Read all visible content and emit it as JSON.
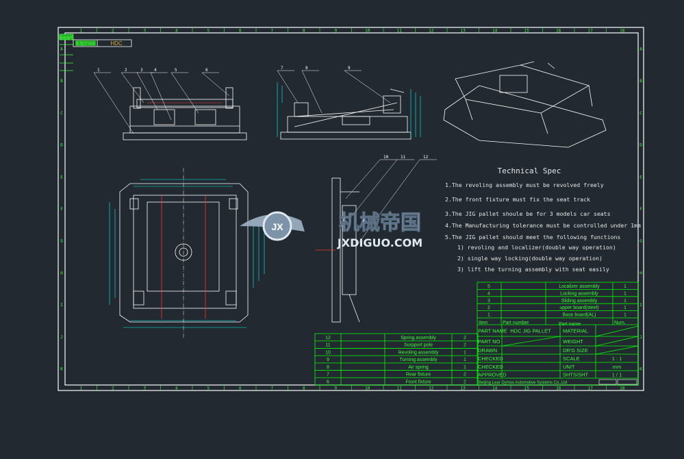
{
  "colors": {
    "background": "#222930",
    "border": "#ffffff",
    "table": "#00ff00",
    "dimension": "#00ffff",
    "geometry": "#ffffff",
    "accent": "#ff3030"
  },
  "frame": {
    "columns": [
      "1",
      "2",
      "3",
      "4",
      "5",
      "6",
      "7",
      "8",
      "9",
      "10",
      "11",
      "12",
      "13",
      "14",
      "15",
      "16",
      "17",
      "18"
    ],
    "rows": [
      "A",
      "B",
      "C",
      "D",
      "E",
      "F",
      "G",
      "H",
      "I",
      "J",
      "K"
    ],
    "corner_label": "图纸编号",
    "type_label": "车型/TYPE",
    "type_value": "HDC"
  },
  "balloons": {
    "front": [
      "1",
      "2",
      "3",
      "4",
      "5",
      "6"
    ],
    "side": [
      "7",
      "8",
      "9"
    ],
    "section": [
      "10",
      "11",
      "12"
    ]
  },
  "spec": {
    "title": "Technical Spec",
    "items": [
      "1.The revoling assembly must be revolved freely",
      "2.The front fixture must fix the seat track",
      "3.The JIG pallet shoule be for 3 models car seats",
      "4.The Manufacturing tolerance must be controlled under 1mm",
      "5.The JIG pallet should meet the following functions"
    ],
    "subitems": [
      "1) revoling and localizer(double way operation)",
      "2) single way locking(double way operation)",
      "3) lift the turning assembly with seat easily"
    ]
  },
  "parts_upper": [
    {
      "item": "5",
      "number": "",
      "name": "Localizer assembly",
      "num": "1"
    },
    {
      "item": "4",
      "number": "",
      "name": "Locking assembly",
      "num": "1"
    },
    {
      "item": "3",
      "number": "",
      "name": "Sliding assembly",
      "num": "1"
    },
    {
      "item": "2",
      "number": "",
      "name": "upper board(steel)",
      "num": "1"
    },
    {
      "item": "1",
      "number": "",
      "name": "Base board(AL)",
      "num": "1"
    }
  ],
  "parts_header": {
    "item": "Item",
    "number": "Part number",
    "name": "Part name",
    "num": "Num."
  },
  "parts_lower": [
    {
      "item": "12",
      "number": "",
      "name": "Spring assembly",
      "num": "2"
    },
    {
      "item": "11",
      "number": "",
      "name": "Surpport pole",
      "num": "2"
    },
    {
      "item": "10",
      "number": "",
      "name": "Revoling assembly",
      "num": "1"
    },
    {
      "item": "9",
      "number": "",
      "name": "Turning assembly",
      "num": "1"
    },
    {
      "item": "8",
      "number": "",
      "name": "Air spring",
      "num": "1"
    },
    {
      "item": "7",
      "number": "",
      "name": "Rear fixture",
      "num": "2"
    },
    {
      "item": "6",
      "number": "",
      "name": "Front fixture",
      "num": "2"
    }
  ],
  "title_block": {
    "left": [
      {
        "label": "PART NAME",
        "value": "HDC JIG PALLET"
      },
      {
        "label": "PART NO",
        "value": ""
      },
      {
        "label": "DRAWN",
        "value": ""
      },
      {
        "label": "CHECKED",
        "value": ""
      },
      {
        "label": "CHECKED",
        "value": ""
      },
      {
        "label": "APPROVED",
        "value": ""
      }
    ],
    "right": [
      {
        "label": "MATERIAL",
        "value": ""
      },
      {
        "label": "WEIGHT",
        "value": ""
      },
      {
        "label": "DR'G SIZE",
        "value": ""
      },
      {
        "label": "SCALE",
        "value": "1 : 1"
      },
      {
        "label": "UNIT",
        "value": "mm"
      },
      {
        "label": "SHTS/SHT",
        "value": "1 / 1"
      }
    ],
    "company": "Beijing Lear Dymos Automotive Systems Co.,Ltd"
  },
  "watermark": {
    "cn": "机械帝国",
    "en": "JXDIGUO.COM",
    "badge": "JX"
  }
}
